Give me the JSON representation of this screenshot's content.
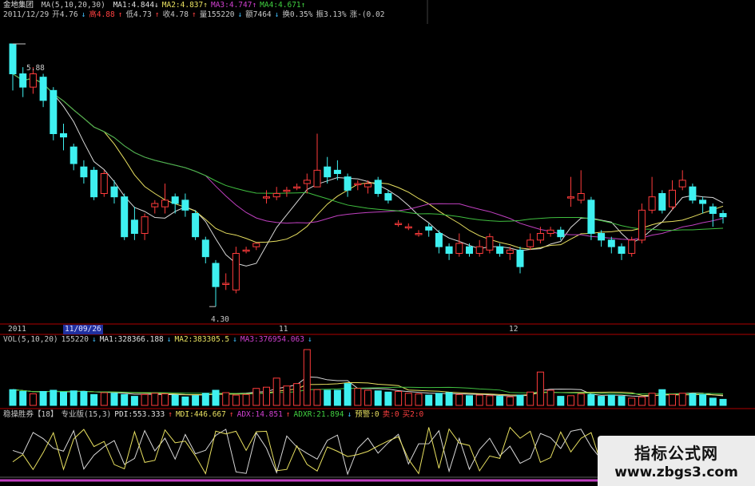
{
  "colors": {
    "up": "#ff3b3b",
    "down": "#3ef0f0",
    "ma1": "#d8d8d8",
    "ma2": "#e8e060",
    "ma3": "#c040c0",
    "ma4": "#40c040",
    "text": "#c8c8c8",
    "axis": "#b00000"
  },
  "header": {
    "stock_name": "金地集团",
    "ma_label": "MA(5,10,20,30)",
    "ma_values": [
      {
        "label": "MA1:4.844",
        "arrow": "↓",
        "color": "#e0e0e0"
      },
      {
        "label": "MA2:4.837",
        "arrow": "↑",
        "color": "#e8e060"
      },
      {
        "label": "MA3:4.747",
        "arrow": "↑",
        "color": "#d040d0"
      },
      {
        "label": "MA4:4.671",
        "arrow": "↑",
        "color": "#40d040"
      }
    ],
    "quote": [
      {
        "text": "2011/12/29",
        "color": "#c8c8c8"
      },
      {
        "text": "开4.76",
        "color": "#c8c8c8"
      },
      {
        "text": "↓",
        "color": "#40c0ff"
      },
      {
        "text": "高4.88",
        "color": "#ff4040"
      },
      {
        "text": "↑",
        "color": "#ff4040"
      },
      {
        "text": "低4.73",
        "color": "#c8c8c8"
      },
      {
        "text": "↑",
        "color": "#ff4040"
      },
      {
        "text": "收4.78",
        "color": "#c8c8c8"
      },
      {
        "text": "↑",
        "color": "#ff4040"
      },
      {
        "text": "量155220",
        "color": "#c8c8c8"
      },
      {
        "text": "↓",
        "color": "#40c0ff"
      },
      {
        "text": "额7464",
        "color": "#c8c8c8"
      },
      {
        "text": "↓",
        "color": "#40c0ff"
      },
      {
        "text": "换0.35%",
        "color": "#c8c8c8"
      },
      {
        "text": "振3.13%",
        "color": "#c8c8c8"
      },
      {
        "text": "涨-(0.02",
        "color": "#c8c8c8"
      }
    ]
  },
  "price_labels": {
    "high": "5.88",
    "low": "4.30"
  },
  "timeline": {
    "year": "2011",
    "cursor_date": "11/09/26",
    "month1": "11",
    "month2": "12"
  },
  "vol_header": [
    {
      "text": "VOL(5,10,20)",
      "color": "#c8c8c8"
    },
    {
      "text": "155220",
      "color": "#c8c8c8"
    },
    {
      "text": "↓",
      "color": "#40c0ff"
    },
    {
      "text": "MA1:328366.188",
      "color": "#e0e0e0"
    },
    {
      "text": "↓",
      "color": "#40c0ff"
    },
    {
      "text": "MA2:383305.5",
      "color": "#e8e060"
    },
    {
      "text": "↓",
      "color": "#40c0ff"
    },
    {
      "text": "MA3:376954.063",
      "color": "#d040d0"
    },
    {
      "text": "↓",
      "color": "#40c0ff"
    }
  ],
  "ind_header": [
    {
      "text": "稳操胜券【18】",
      "color": "#c8c8c8"
    },
    {
      "text": "专业版(15,3)",
      "color": "#c8c8c8"
    },
    {
      "text": "PDI:553.333",
      "color": "#e0e0e0"
    },
    {
      "text": "↑",
      "color": "#ff4040"
    },
    {
      "text": "MDI:446.667",
      "color": "#e8e060"
    },
    {
      "text": "↑",
      "color": "#ff4040"
    },
    {
      "text": "ADX:14.851",
      "color": "#d040d0"
    },
    {
      "text": "↑",
      "color": "#ff4040"
    },
    {
      "text": "ADXR:21.894",
      "color": "#40d040"
    },
    {
      "text": "↓",
      "color": "#40c0ff"
    },
    {
      "text": "预警:0",
      "color": "#e8e060"
    },
    {
      "text": "卖:0",
      "color": "#ff4040"
    },
    {
      "text": "买2:0",
      "color": "#ff4040"
    }
  ],
  "watermark": {
    "title": "指标公式网",
    "url": "www.zbgs3.com"
  },
  "chart_data": {
    "type": "candlestick",
    "price_ylim": [
      4.2,
      6.0
    ],
    "candles": [
      {
        "o": 5.88,
        "c": 5.7,
        "h": 5.88,
        "l": 5.6
      },
      {
        "o": 5.7,
        "c": 5.62,
        "h": 5.74,
        "l": 5.56
      },
      {
        "o": 5.62,
        "c": 5.7,
        "h": 5.74,
        "l": 5.58
      },
      {
        "o": 5.68,
        "c": 5.54,
        "h": 5.7,
        "l": 5.5
      },
      {
        "o": 5.6,
        "c": 5.34,
        "h": 5.62,
        "l": 5.3
      },
      {
        "o": 5.34,
        "c": 5.32,
        "h": 5.4,
        "l": 5.24
      },
      {
        "o": 5.26,
        "c": 5.16,
        "h": 5.28,
        "l": 5.12
      },
      {
        "o": 5.14,
        "c": 5.08,
        "h": 5.18,
        "l": 5.04
      },
      {
        "o": 5.12,
        "c": 4.96,
        "h": 5.14,
        "l": 4.94
      },
      {
        "o": 4.98,
        "c": 5.1,
        "h": 5.12,
        "l": 4.96
      },
      {
        "o": 5.02,
        "c": 4.96,
        "h": 5.06,
        "l": 4.92
      },
      {
        "o": 4.96,
        "c": 4.72,
        "h": 4.98,
        "l": 4.7
      },
      {
        "o": 4.82,
        "c": 4.74,
        "h": 4.9,
        "l": 4.7
      },
      {
        "o": 4.74,
        "c": 4.84,
        "h": 4.86,
        "l": 4.7
      },
      {
        "o": 4.9,
        "c": 4.92,
        "h": 4.94,
        "l": 4.86
      },
      {
        "o": 4.9,
        "c": 4.94,
        "h": 5.04,
        "l": 4.86
      },
      {
        "o": 4.96,
        "c": 4.92,
        "h": 4.98,
        "l": 4.86
      },
      {
        "o": 4.94,
        "c": 4.88,
        "h": 4.98,
        "l": 4.84
      },
      {
        "o": 4.86,
        "c": 4.72,
        "h": 4.88,
        "l": 4.7
      },
      {
        "o": 4.7,
        "c": 4.6,
        "h": 4.72,
        "l": 4.56
      },
      {
        "o": 4.56,
        "c": 4.42,
        "h": 4.58,
        "l": 4.3
      },
      {
        "o": 4.44,
        "c": 4.44,
        "h": 4.5,
        "l": 4.4
      },
      {
        "o": 4.4,
        "c": 4.62,
        "h": 4.66,
        "l": 4.38
      },
      {
        "o": 4.64,
        "c": 4.64,
        "h": 4.66,
        "l": 4.62
      },
      {
        "o": 4.66,
        "c": 4.68,
        "h": 4.68,
        "l": 4.64
      },
      {
        "o": 4.96,
        "c": 4.96,
        "h": 5.0,
        "l": 4.92
      },
      {
        "o": 4.96,
        "c": 4.98,
        "h": 5.02,
        "l": 4.94
      },
      {
        "o": 5.0,
        "c": 5.0,
        "h": 5.02,
        "l": 4.96
      },
      {
        "o": 5.02,
        "c": 5.02,
        "h": 5.04,
        "l": 5.0
      },
      {
        "o": 5.04,
        "c": 5.06,
        "h": 5.1,
        "l": 4.98
      },
      {
        "o": 5.02,
        "c": 5.12,
        "h": 5.34,
        "l": 5.02
      },
      {
        "o": 5.14,
        "c": 5.08,
        "h": 5.2,
        "l": 5.04
      },
      {
        "o": 5.12,
        "c": 5.1,
        "h": 5.18,
        "l": 5.06
      },
      {
        "o": 5.08,
        "c": 5.0,
        "h": 5.1,
        "l": 4.96
      },
      {
        "o": 5.04,
        "c": 5.04,
        "h": 5.06,
        "l": 5.0
      },
      {
        "o": 5.02,
        "c": 5.04,
        "h": 5.06,
        "l": 4.98
      },
      {
        "o": 5.06,
        "c": 4.98,
        "h": 5.08,
        "l": 4.96
      },
      {
        "o": 4.98,
        "c": 4.94,
        "h": 5.0,
        "l": 4.92
      },
      {
        "o": 4.8,
        "c": 4.8,
        "h": 4.82,
        "l": 4.78
      },
      {
        "o": 4.78,
        "c": 4.78,
        "h": 4.8,
        "l": 4.76
      },
      {
        "o": 4.74,
        "c": 4.74,
        "h": 4.76,
        "l": 4.72
      },
      {
        "o": 4.78,
        "c": 4.76,
        "h": 4.8,
        "l": 4.72
      },
      {
        "o": 4.74,
        "c": 4.66,
        "h": 4.76,
        "l": 4.62
      },
      {
        "o": 4.66,
        "c": 4.62,
        "h": 4.68,
        "l": 4.58
      },
      {
        "o": 4.62,
        "c": 4.68,
        "h": 4.74,
        "l": 4.6
      },
      {
        "o": 4.66,
        "c": 4.62,
        "h": 4.68,
        "l": 4.6
      },
      {
        "o": 4.62,
        "c": 4.66,
        "h": 4.7,
        "l": 4.6
      },
      {
        "o": 4.64,
        "c": 4.72,
        "h": 4.74,
        "l": 4.62
      },
      {
        "o": 4.66,
        "c": 4.62,
        "h": 4.68,
        "l": 4.6
      },
      {
        "o": 4.62,
        "c": 4.64,
        "h": 4.66,
        "l": 4.58
      },
      {
        "o": 4.64,
        "c": 4.54,
        "h": 4.66,
        "l": 4.5
      },
      {
        "o": 4.66,
        "c": 4.7,
        "h": 4.74,
        "l": 4.64
      },
      {
        "o": 4.7,
        "c": 4.74,
        "h": 4.78,
        "l": 4.68
      },
      {
        "o": 4.74,
        "c": 4.76,
        "h": 4.78,
        "l": 4.72
      },
      {
        "o": 4.76,
        "c": 4.72,
        "h": 4.78,
        "l": 4.7
      },
      {
        "o": 4.96,
        "c": 4.96,
        "h": 5.08,
        "l": 4.9
      },
      {
        "o": 4.94,
        "c": 4.98,
        "h": 5.12,
        "l": 4.92
      },
      {
        "o": 4.94,
        "c": 4.74,
        "h": 4.96,
        "l": 4.7
      },
      {
        "o": 4.74,
        "c": 4.7,
        "h": 4.76,
        "l": 4.66
      },
      {
        "o": 4.7,
        "c": 4.66,
        "h": 4.72,
        "l": 4.62
      },
      {
        "o": 4.66,
        "c": 4.62,
        "h": 4.68,
        "l": 4.58
      },
      {
        "o": 4.62,
        "c": 4.7,
        "h": 4.72,
        "l": 4.6
      },
      {
        "o": 4.7,
        "c": 4.88,
        "h": 4.92,
        "l": 4.68
      },
      {
        "o": 4.88,
        "c": 4.96,
        "h": 5.08,
        "l": 4.86
      },
      {
        "o": 4.98,
        "c": 4.88,
        "h": 5.0,
        "l": 4.86
      },
      {
        "o": 4.9,
        "c": 5.0,
        "h": 5.06,
        "l": 4.88
      },
      {
        "o": 5.02,
        "c": 5.06,
        "h": 5.12,
        "l": 5.0
      },
      {
        "o": 5.02,
        "c": 4.94,
        "h": 5.04,
        "l": 4.92
      },
      {
        "o": 4.94,
        "c": 4.92,
        "h": 4.96,
        "l": 4.86
      },
      {
        "o": 4.9,
        "c": 4.86,
        "h": 4.92,
        "l": 4.78
      },
      {
        "o": 4.86,
        "c": 4.84,
        "h": 4.88,
        "l": 4.8
      }
    ],
    "vol_ylim": [
      0,
      1000000
    ],
    "volume": [
      260,
      230,
      190,
      230,
      250,
      220,
      240,
      230,
      180,
      210,
      200,
      180,
      150,
      180,
      200,
      190,
      170,
      140,
      160,
      200,
      250,
      210,
      170,
      180,
      280,
      300,
      450,
      320,
      360,
      920,
      260,
      250,
      250,
      360,
      280,
      250,
      240,
      220,
      230,
      200,
      190,
      170,
      200,
      210,
      180,
      160,
      170,
      160,
      150,
      140,
      170,
      220,
      550,
      250,
      150,
      160,
      190,
      180,
      150,
      170,
      150,
      120,
      140,
      200,
      260,
      180,
      200,
      190,
      180,
      120,
      100
    ]
  }
}
